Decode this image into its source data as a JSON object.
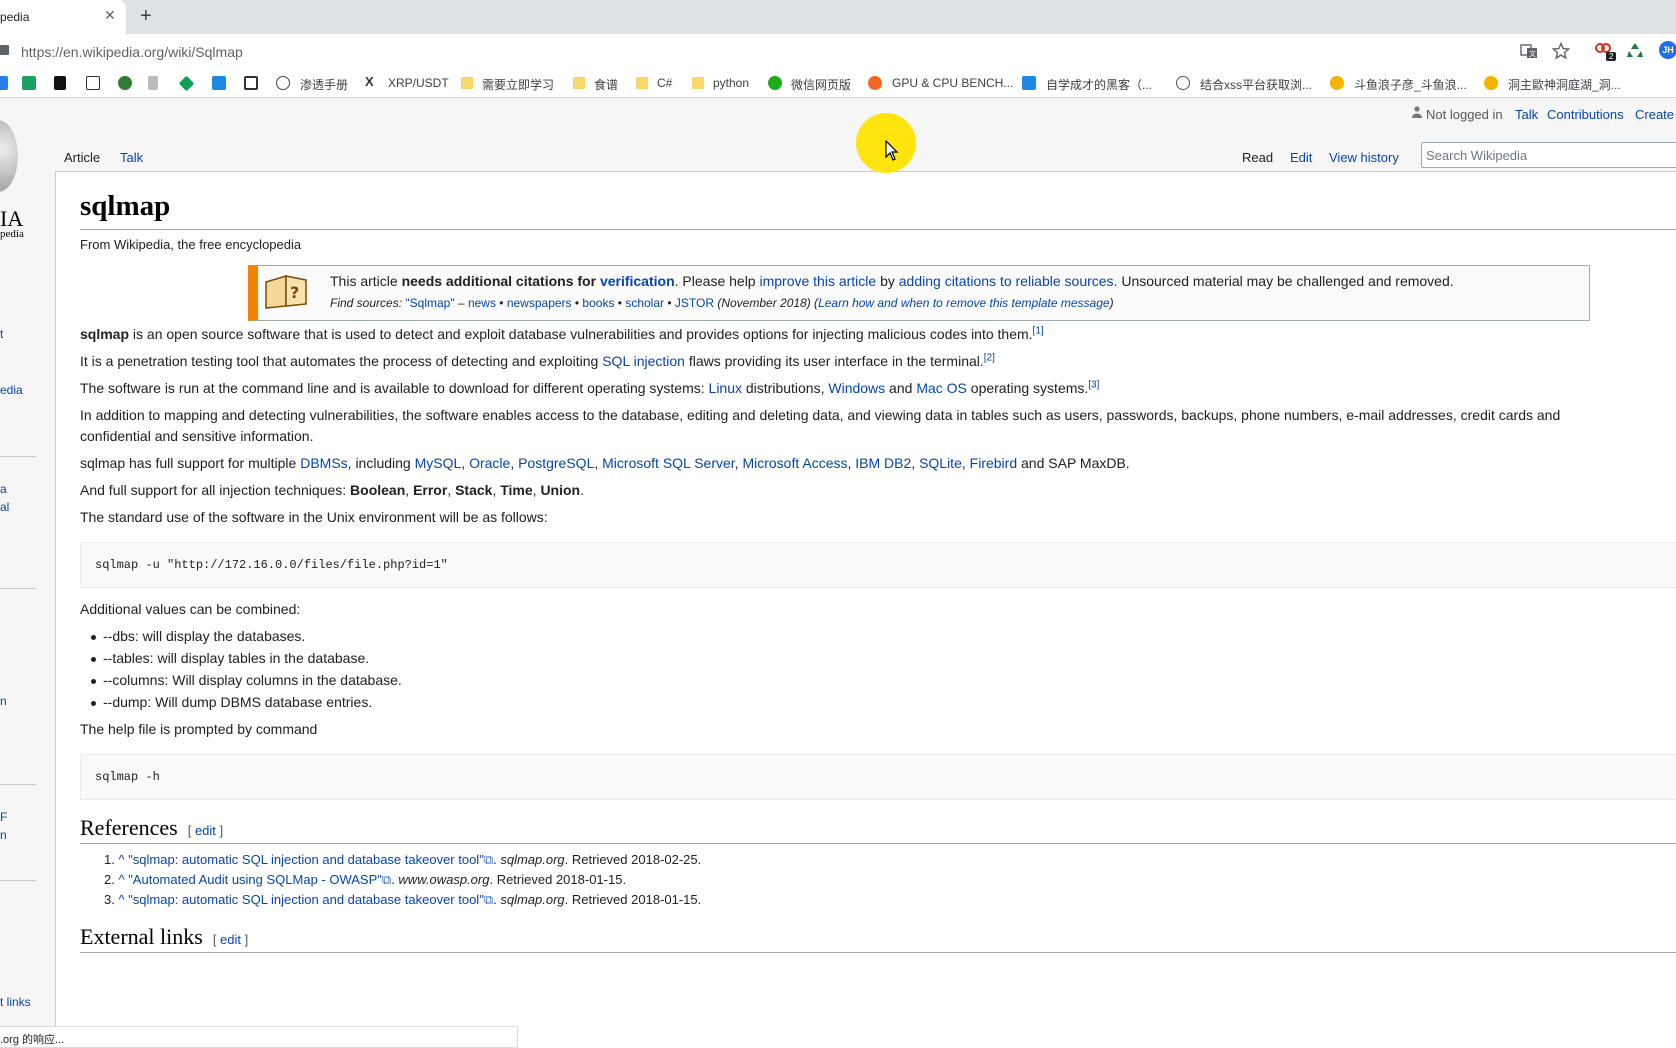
{
  "browser": {
    "tab_title": "pedia",
    "tab_close": "✕",
    "new_tab": "+",
    "url": "https://en.wikipedia.org/wiki/Sqlmap",
    "translate_icon": "translate-icon",
    "star_icon": "star-icon",
    "extension_badge": "2",
    "profile": "JH",
    "bookmarks": [
      {
        "label": "渗透手册"
      },
      {
        "label": "XRP/USDT"
      },
      {
        "label": "需要立即学习"
      },
      {
        "label": "食谱"
      },
      {
        "label": "C#"
      },
      {
        "label": "python"
      },
      {
        "label": "微信网页版"
      },
      {
        "label": "GPU & CPU BENCH..."
      },
      {
        "label": "自学成才的黑客（..."
      },
      {
        "label": "结合xss平台获取浏..."
      },
      {
        "label": "斗鱼浪子彦_斗鱼浪..."
      },
      {
        "label": "洞主歐神洞庭湖_洞..."
      }
    ],
    "status": ".org 的响应..."
  },
  "wiki": {
    "logo_text": "IA",
    "logo_sub": "pedia",
    "sidebar_fragments": [
      "t",
      "edia",
      "a",
      "al",
      "n",
      "F",
      "n",
      "t links"
    ],
    "personal": {
      "not_logged_in": "Not logged in",
      "talk": "Talk",
      "contributions": "Contributions",
      "create": "Create"
    },
    "tabs": {
      "article": "Article",
      "talk": "Talk",
      "read": "Read",
      "edit": "Edit",
      "view_history": "View history"
    },
    "search_placeholder": "Search Wikipedia",
    "title": "sqlmap",
    "from": "From Wikipedia, the free encyclopedia",
    "ambox": {
      "t1": "This article ",
      "t2": "needs additional citations for ",
      "t3": "verification",
      "t4": ". Please help ",
      "t5": "improve this article",
      "t6": " by ",
      "t7": "adding citations to reliable sources",
      "t8": ". Unsourced material may be challenged and removed.",
      "f1": "Find sources: ",
      "f2": "\"Sqlmap\"",
      "f3": " – ",
      "f4": "news",
      "f5": " • ",
      "f6": "newspapers",
      "f7": "books",
      "f8": "scholar",
      "f9": "JSTOR",
      "f10": " (November 2018) (",
      "f11": "Learn how and when to remove this template message",
      "f12": ")"
    },
    "p1": {
      "b": "sqlmap",
      "rest": " is an open source software that is used to detect and exploit database vulnerabilities and provides options for injecting malicious codes into them.",
      "ref": "[1]"
    },
    "p2": {
      "a": "It is a penetration testing tool that automates the process of detecting and exploiting ",
      "link": "SQL injection",
      "b": " flaws providing its user interface in the terminal.",
      "ref": "[2]"
    },
    "p3": {
      "a": "The software is run at the command line and is available to download for different operating systems: ",
      "l1": "Linux",
      "b": " distributions, ",
      "l2": "Windows",
      "c": " and ",
      "l3": "Mac OS",
      "d": " operating systems.",
      "ref": "[3]"
    },
    "p4": {
      "l1": "In addition to mapping and detecting vulnerabilities, the software enables access to the database, editing and deleting data, and viewing data in tables such as users, passwords, backups, phone numbers, e-mail addresses, credit cards and",
      "l2": "confidential and sensitive information."
    },
    "p5": {
      "a": "sqlmap has full support for multiple ",
      "dbms": "DBMSs",
      "b": ", including ",
      "mysql": "MySQL",
      "oracle": "Oracle",
      "pg": "PostgreSQL",
      "mssql": "Microsoft SQL Server",
      "access": "Microsoft Access",
      "db2": "IBM DB2",
      "sqlite": "SQLite",
      "firebird": "Firebird",
      "comma": ", ",
      "end": " and SAP MaxDB."
    },
    "p6": {
      "a": "And full support for all injection techniques: ",
      "boolean": "Boolean",
      "error": "Error",
      "stack": "Stack",
      "time": "Time",
      "union": "Union",
      "comma": ", ",
      "dot": "."
    },
    "p7": "The standard use of the software in the Unix environment will be as follows:",
    "code1": "sqlmap -u \"http://172.16.0.0/files/file.php?id=1\"",
    "p8": "Additional values can be combined:",
    "list": [
      "--dbs: will display the databases.",
      "--tables: will display tables in the database.",
      "--columns: Will display columns in the database.",
      "--dump: Will dump DBMS database entries."
    ],
    "p9": "The help file is prompted by command",
    "code2": "sqlmap -h",
    "references": {
      "heading": "References",
      "edit_open": "[ ",
      "edit": "edit",
      "edit_close": " ]",
      "items": [
        {
          "num": "1. ",
          "caret": "^ ",
          "title": "\"sqlmap: automatic SQL injection and database takeover tool\"",
          "site": "sqlmap.org",
          "retrieved": ". Retrieved 2018-02-25."
        },
        {
          "num": "2. ",
          "caret": "^ ",
          "title": "\"Automated Audit using SQLMap - OWASP\"",
          "site": "www.owasp.org",
          "retrieved": ". Retrieved 2018-01-15."
        },
        {
          "num": "3. ",
          "caret": "^ ",
          "title": "\"sqlmap: automatic SQL injection and database takeover tool\"",
          "site": "sqlmap.org",
          "retrieved": ". Retrieved 2018-01-15."
        }
      ]
    },
    "external": {
      "heading": "External links",
      "edit": "edit"
    },
    "colors": {
      "link": "#0645ad",
      "ambox_border": "#f28500",
      "cursor_highlight": "#ffe400"
    }
  }
}
